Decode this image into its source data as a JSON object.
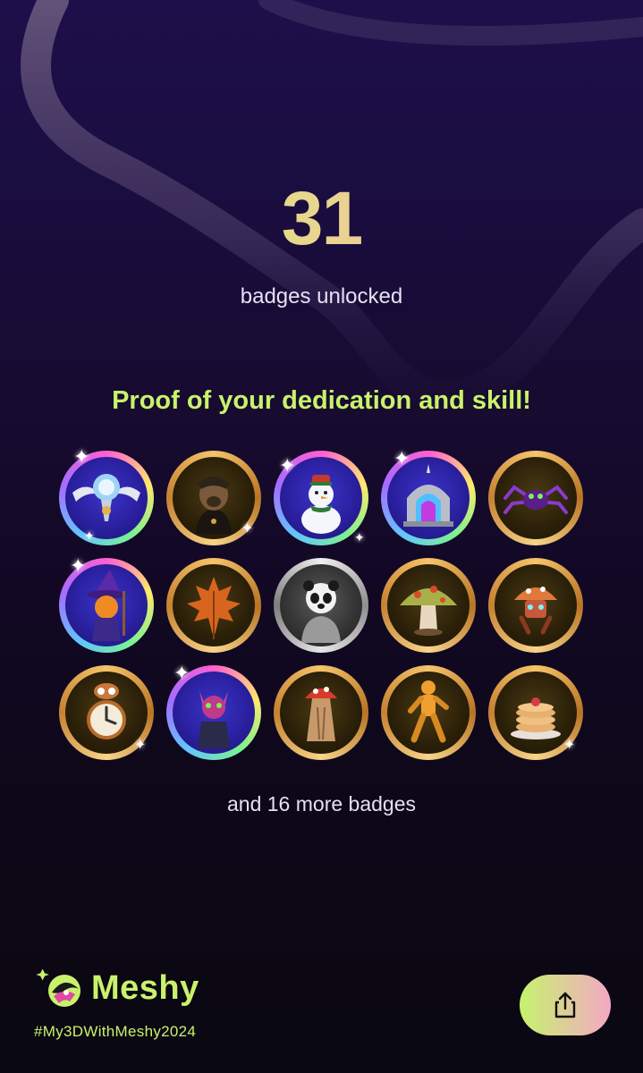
{
  "summary": {
    "count": "31",
    "count_label": "badges unlocked",
    "headline": "Proof of your dedication and skill!",
    "more_label": "and 16 more badges"
  },
  "badges": [
    {
      "name": "winged-crystal-emblem",
      "frame": "rainbow"
    },
    {
      "name": "hooded-dog-figure",
      "frame": "gold"
    },
    {
      "name": "snowman",
      "frame": "rainbow"
    },
    {
      "name": "spiked-portal-gate",
      "frame": "rainbow"
    },
    {
      "name": "purple-spider",
      "frame": "gold"
    },
    {
      "name": "pumpkin-wizard",
      "frame": "rainbow"
    },
    {
      "name": "autumn-maple-leaf",
      "frame": "gold"
    },
    {
      "name": "panda-in-sweater",
      "frame": "silver"
    },
    {
      "name": "spotted-mushroom",
      "frame": "gold"
    },
    {
      "name": "mushroom-robot",
      "frame": "gold"
    },
    {
      "name": "clock-robot",
      "frame": "gold"
    },
    {
      "name": "cyber-cat",
      "frame": "rainbow"
    },
    {
      "name": "mushroom-tree-stump",
      "frame": "gold"
    },
    {
      "name": "orange-armored-runner",
      "frame": "gold"
    },
    {
      "name": "pancake-stack",
      "frame": "gold"
    }
  ],
  "brand": {
    "name": "Meshy",
    "hashtag": "#My3DWithMeshy2024",
    "logo_icon": "meshy-logo-icon"
  },
  "actions": {
    "share_icon": "share-icon"
  },
  "colors": {
    "accent_green": "#c9f26a",
    "accent_pink": "#f4a8c4",
    "gold_frame": "#e0a24a",
    "background_top": "#1e0f4a",
    "background_bottom": "#0a0812"
  }
}
